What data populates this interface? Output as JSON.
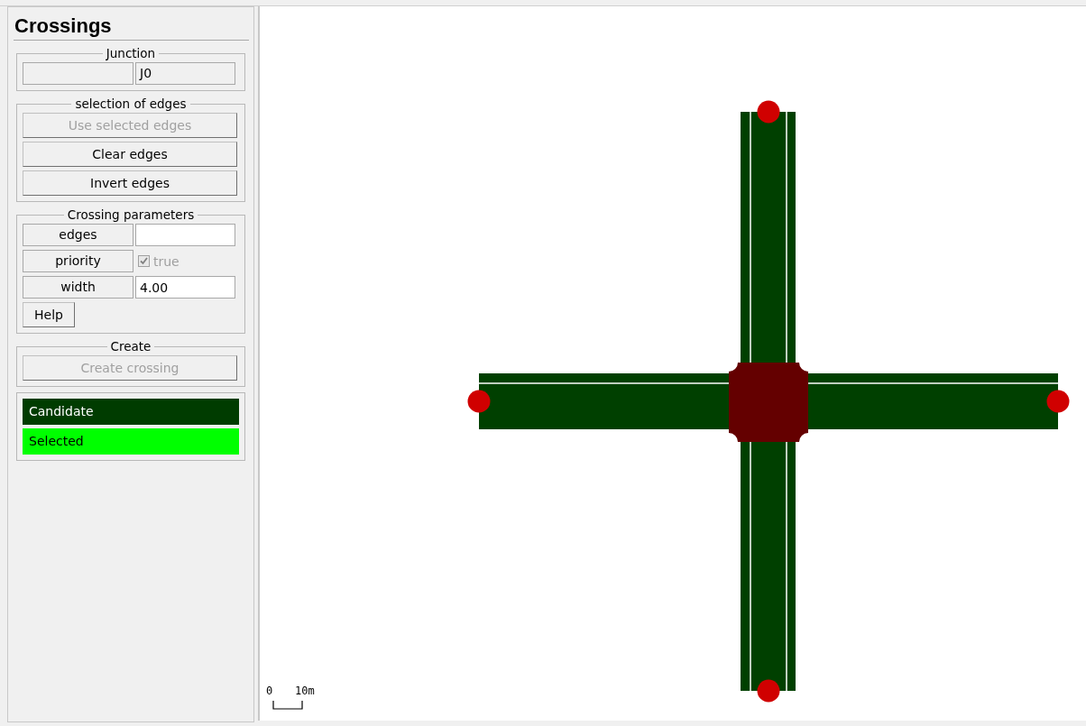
{
  "panel": {
    "title": "Crossings",
    "junction": {
      "legend": "Junction",
      "value": "J0"
    },
    "edge_selection": {
      "legend": "selection of edges",
      "buttons": [
        {
          "label": "Use selected edges",
          "disabled": true
        },
        {
          "label": "Clear edges",
          "disabled": false
        },
        {
          "label": "Invert edges",
          "disabled": false
        }
      ]
    },
    "parameters": {
      "legend": "Crossing parameters",
      "rows": [
        {
          "kind": "text",
          "label": "edges",
          "value": ""
        },
        {
          "kind": "checkbox",
          "label": "priority",
          "value": "true",
          "checked": true,
          "disabled": true
        },
        {
          "kind": "text",
          "label": "width",
          "value": "4.00"
        }
      ],
      "help_button": "Help"
    },
    "create": {
      "legend": "Create",
      "button": {
        "label": "Create crossing",
        "disabled": true
      }
    },
    "legend": [
      {
        "label": "Candidate",
        "color": "#003c00"
      },
      {
        "label": "Selected",
        "color": "#00ff00"
      }
    ]
  },
  "canvas": {
    "scale_bar": {
      "start": "0",
      "end": "10m"
    }
  }
}
